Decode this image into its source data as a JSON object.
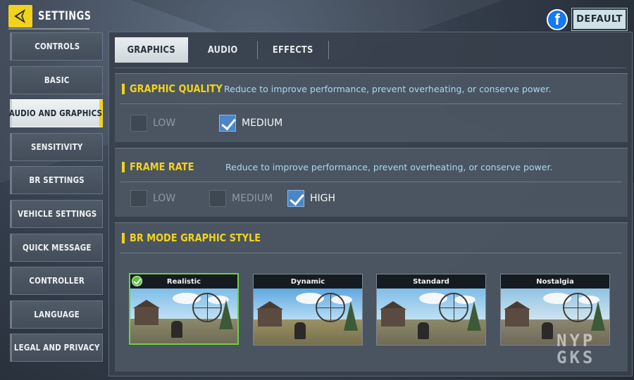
{
  "header": {
    "title": "SETTINGS",
    "default_label": "DEFAULT",
    "facebook_glyph": "f"
  },
  "sidebar": {
    "items": [
      {
        "label": "CONTROLS"
      },
      {
        "label": "BASIC"
      },
      {
        "label": "AUDIO AND GRAPHICS",
        "active": true
      },
      {
        "label": "SENSITIVITY"
      },
      {
        "label": "BR SETTINGS"
      },
      {
        "label": "VEHICLE SETTINGS"
      },
      {
        "label": "QUICK MESSAGE"
      },
      {
        "label": "CONTROLLER"
      },
      {
        "label": "LANGUAGE"
      },
      {
        "label": "LEGAL AND PRIVACY"
      }
    ]
  },
  "tabs": [
    {
      "label": "GRAPHICS",
      "active": true
    },
    {
      "label": "AUDIO"
    },
    {
      "label": "EFFECTS"
    }
  ],
  "graphic_quality": {
    "title": "GRAPHIC QUALITY",
    "description": "Reduce to improve performance, prevent overheating, or conserve power.",
    "options": [
      {
        "label": "LOW",
        "checked": false
      },
      {
        "label": "MEDIUM",
        "checked": true
      }
    ]
  },
  "frame_rate": {
    "title": "FRAME RATE",
    "description": "Reduce to improve performance, prevent overheating, or conserve power.",
    "options": [
      {
        "label": "LOW",
        "checked": false
      },
      {
        "label": "MEDIUM",
        "checked": false
      },
      {
        "label": "HIGH",
        "checked": true
      }
    ]
  },
  "br_mode": {
    "title": "BR MODE GRAPHIC STYLE",
    "styles": [
      {
        "label": "Realistic",
        "selected": true
      },
      {
        "label": "Dynamic",
        "selected": false
      },
      {
        "label": "Standard",
        "selected": false
      },
      {
        "label": "Nostalgia",
        "selected": false
      }
    ]
  },
  "watermark": {
    "line1": "NYP",
    "line2": "GKS"
  },
  "colors": {
    "accent_yellow": "#f2d21b",
    "checkbox_blue": "#4a86c8",
    "selected_green": "#6cd23f",
    "desc_blue": "#a9d9f0"
  }
}
